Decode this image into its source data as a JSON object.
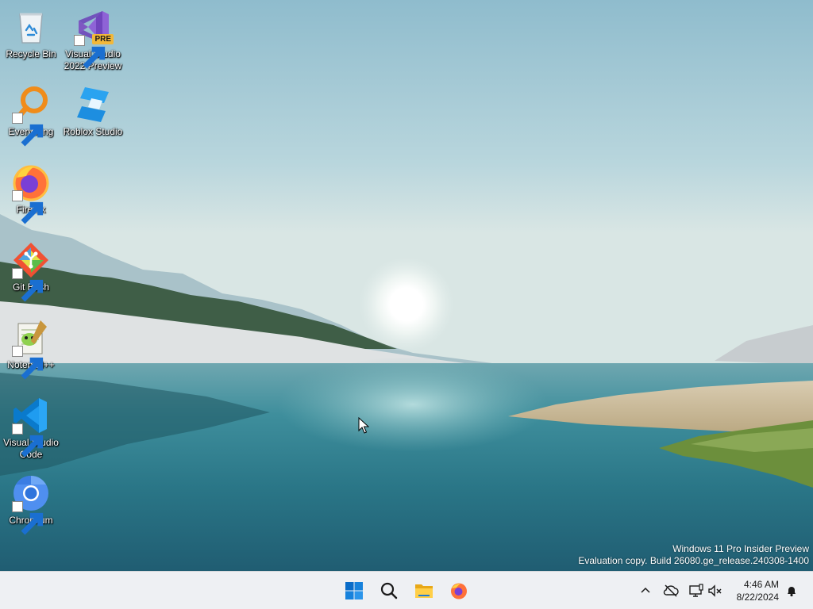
{
  "desktop": {
    "icons": [
      {
        "label": "Recycle Bin",
        "icon": "recycle-bin-icon"
      },
      {
        "label": "Visual Studio 2022 Preview",
        "icon": "visual-studio-preview-icon",
        "badge": "PRE"
      },
      {
        "label": "Everything",
        "icon": "everything-search-icon"
      },
      {
        "label": "Roblox Studio",
        "icon": "roblox-studio-icon"
      },
      {
        "label": "Firefox",
        "icon": "firefox-icon"
      },
      {
        "label": "Git Bash",
        "icon": "git-bash-icon"
      },
      {
        "label": "Notepad++",
        "icon": "notepad-plus-plus-icon"
      },
      {
        "label": "Visual Studio Code",
        "icon": "vscode-icon"
      },
      {
        "label": "Chromium",
        "icon": "chromium-icon"
      }
    ]
  },
  "watermark": {
    "line1": "Windows 11 Pro Insider Preview",
    "line2": "Evaluation copy. Build 26080.ge_release.240308-1400"
  },
  "taskbar": {
    "pinned": [
      {
        "name": "start-button",
        "icon": "windows-logo-icon"
      },
      {
        "name": "search-button",
        "icon": "search-icon"
      },
      {
        "name": "file-explorer-button",
        "icon": "folder-icon"
      },
      {
        "name": "firefox-taskbar-button",
        "icon": "firefox-icon"
      }
    ],
    "tray": {
      "icons": [
        "chevron-up-icon",
        "network-disconnected-icon",
        "display-icon",
        "speaker-muted-icon"
      ],
      "time": "4:46 AM",
      "date": "8/22/2024",
      "notification_icon": "bell-icon"
    }
  },
  "colors": {
    "accent": "#0067c0",
    "sky_top": "#9cc3d3",
    "lake": "#2f7d8e",
    "taskbar": "#eef0f3"
  }
}
